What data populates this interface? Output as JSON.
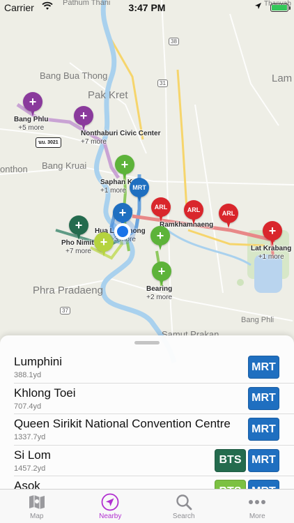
{
  "status_bar": {
    "carrier": "Carrier",
    "time": "3:47 PM"
  },
  "map": {
    "places": {
      "pathum_thani": "Pathum Thani",
      "bang_bua_thong": "Bang Bua Thong",
      "pak_kret": "Pak Kret",
      "lam": "Lam",
      "nonthon": "onthon",
      "bang_kruai": "Bang Kruai",
      "phra_pradaeng": "Phra Pradaeng",
      "bang_phli": "Bang Phli",
      "samut_prakan": "Samut Prakan",
      "thanyaburi": "Thanyab"
    },
    "shields": {
      "r38": "38",
      "r31": "31",
      "r37": "37",
      "r3021": "นบ. 3021"
    },
    "stations": {
      "bang_phlu": {
        "name": "Bang Phlu",
        "more": "+5 more"
      },
      "nonthaburi": {
        "name": "Nonthaburi Civic Center",
        "more": "+7 more"
      },
      "saphan": {
        "name": "Saphan Kwai",
        "more": "+1 more"
      },
      "hua_lamphong": {
        "name": "Hua Lamphong",
        "more": "+3 more"
      },
      "pho_nimit": {
        "name": "Pho Nimit",
        "more": "+7 more"
      },
      "ramkhamhaeng": {
        "name": "Ramkhamhaeng"
      },
      "lat_krabang": {
        "name": "Lat Krabang",
        "more": "+1 more"
      },
      "bearing": {
        "name": "Bearing",
        "more": "+2 more"
      }
    },
    "pin_labels": {
      "mrt": "MRT",
      "arl": "ARL",
      "plus": "+"
    }
  },
  "nearby": {
    "stations": [
      {
        "name": "Lumphini",
        "distance": "388.1yd",
        "lines": [
          "MRT"
        ]
      },
      {
        "name": "Khlong Toei",
        "distance": "707.4yd",
        "lines": [
          "MRT"
        ]
      },
      {
        "name": "Queen Sirikit National Convention Centre",
        "distance": "1337.7yd",
        "lines": [
          "MRT"
        ]
      },
      {
        "name": "Si Lom",
        "distance": "1457.2yd",
        "lines": [
          "BTS",
          "MRT"
        ]
      },
      {
        "name": "Asok",
        "distance": "",
        "lines": [
          "BTS",
          "MRT"
        ]
      }
    ]
  },
  "tabs": [
    {
      "label": "Map",
      "icon": "map-icon",
      "active": false
    },
    {
      "label": "Nearby",
      "icon": "location-arrow-icon",
      "active": true
    },
    {
      "label": "Search",
      "icon": "search-icon",
      "active": false
    },
    {
      "label": "More",
      "icon": "more-icon",
      "active": false
    }
  ],
  "colors": {
    "mrt": "#1f6fc0",
    "bts_silom": "#246b4e",
    "bts_sukhumvit": "#7cc142",
    "arl": "#d9262c",
    "purple_line": "#8a3a9c",
    "tab_active": "#b12fd0"
  }
}
